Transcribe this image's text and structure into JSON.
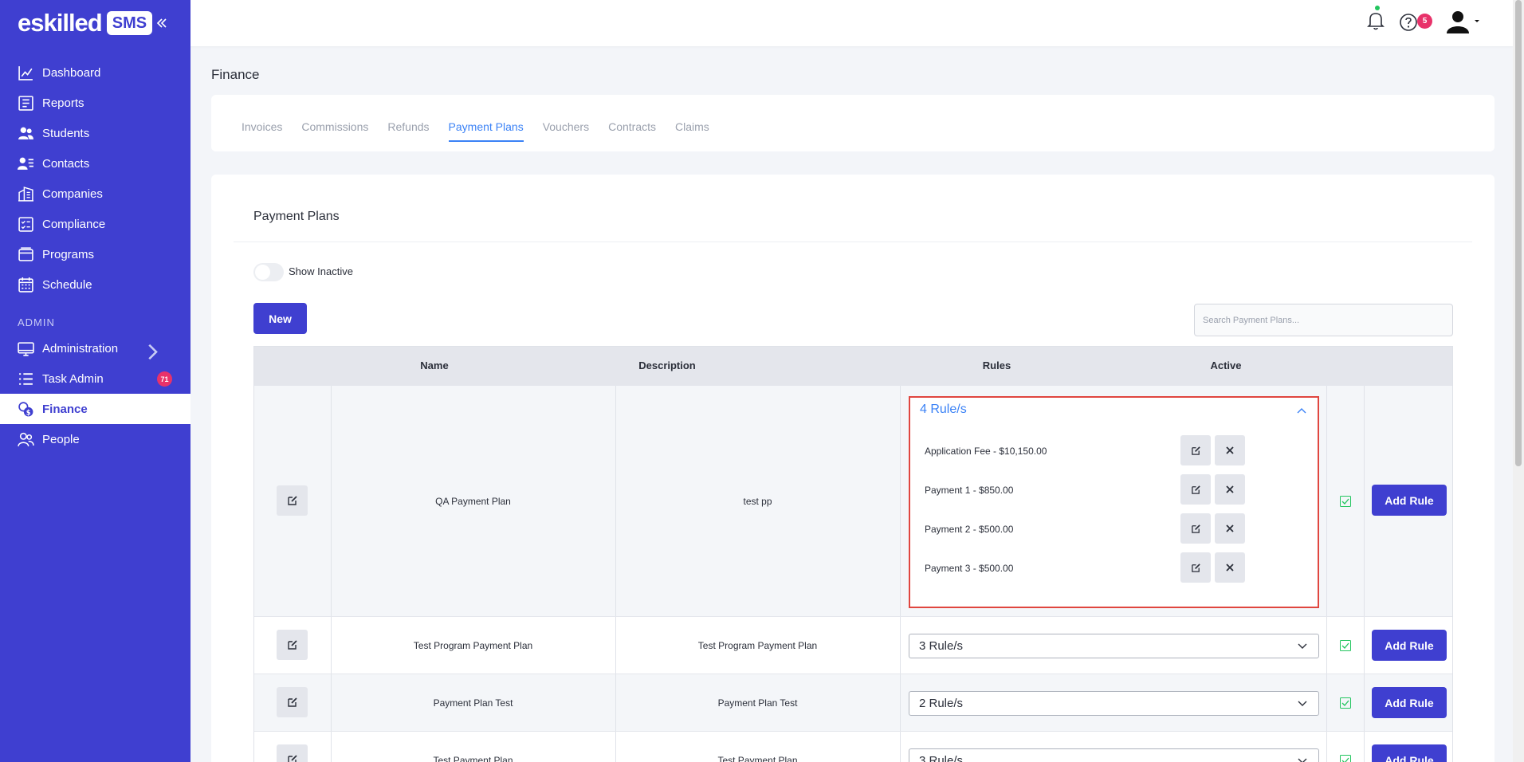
{
  "brand": {
    "name": "eskilled",
    "badge": "SMS"
  },
  "sidebar": {
    "items": [
      {
        "label": "Dashboard",
        "icon": "chart-line-icon"
      },
      {
        "label": "Reports",
        "icon": "report-icon"
      },
      {
        "label": "Students",
        "icon": "users-icon"
      },
      {
        "label": "Contacts",
        "icon": "contact-card-icon"
      },
      {
        "label": "Companies",
        "icon": "building-icon"
      },
      {
        "label": "Compliance",
        "icon": "checklist-icon"
      },
      {
        "label": "Programs",
        "icon": "stack-icon"
      },
      {
        "label": "Schedule",
        "icon": "calendar-icon"
      }
    ],
    "section": "ADMIN",
    "admin_items": [
      {
        "label": "Administration",
        "icon": "monitor-icon"
      },
      {
        "label": "Task Admin",
        "icon": "list-icon",
        "badge": "71"
      },
      {
        "label": "Finance",
        "icon": "coins-icon",
        "active": true
      },
      {
        "label": "People",
        "icon": "people-icon"
      }
    ]
  },
  "topbar": {
    "help_badge": "5"
  },
  "page": {
    "title": "Finance"
  },
  "tabs": [
    "Invoices",
    "Commissions",
    "Refunds",
    "Payment Plans",
    "Vouchers",
    "Contracts",
    "Claims"
  ],
  "active_tab": "Payment Plans",
  "card": {
    "title": "Payment Plans",
    "toggle_label": "Show Inactive",
    "new_button": "New",
    "search_placeholder": "Search Payment Plans..."
  },
  "table": {
    "headers": {
      "name": "Name",
      "description": "Description",
      "rules": "Rules",
      "active": "Active"
    },
    "rows": [
      {
        "name": "QA Payment Plan",
        "description": "test pp",
        "rules_label": "4 Rule/s",
        "expanded": true,
        "rules": [
          "Application Fee - $10,150.00",
          "Payment 1 - $850.00",
          "Payment 2 - $500.00",
          "Payment 3 - $500.00"
        ],
        "active": true,
        "add_rule": "Add Rule"
      },
      {
        "name": "Test Program Payment Plan",
        "description": "Test Program Payment Plan",
        "rules_label": "3 Rule/s",
        "active": true,
        "add_rule": "Add Rule"
      },
      {
        "name": "Payment Plan Test",
        "description": "Payment Plan Test",
        "rules_label": "2 Rule/s",
        "active": true,
        "add_rule": "Add Rule"
      },
      {
        "name": "Test Payment Plan",
        "description": "Test Payment Plan",
        "rules_label": "3 Rule/s",
        "active": true,
        "add_rule": "Add Rule"
      }
    ]
  },
  "colors": {
    "sidebar": "#3f3fd0",
    "accent": "#3b82f6",
    "badge": "#e8326a",
    "highlight_border": "#e0463f",
    "check": "#22c55e"
  }
}
